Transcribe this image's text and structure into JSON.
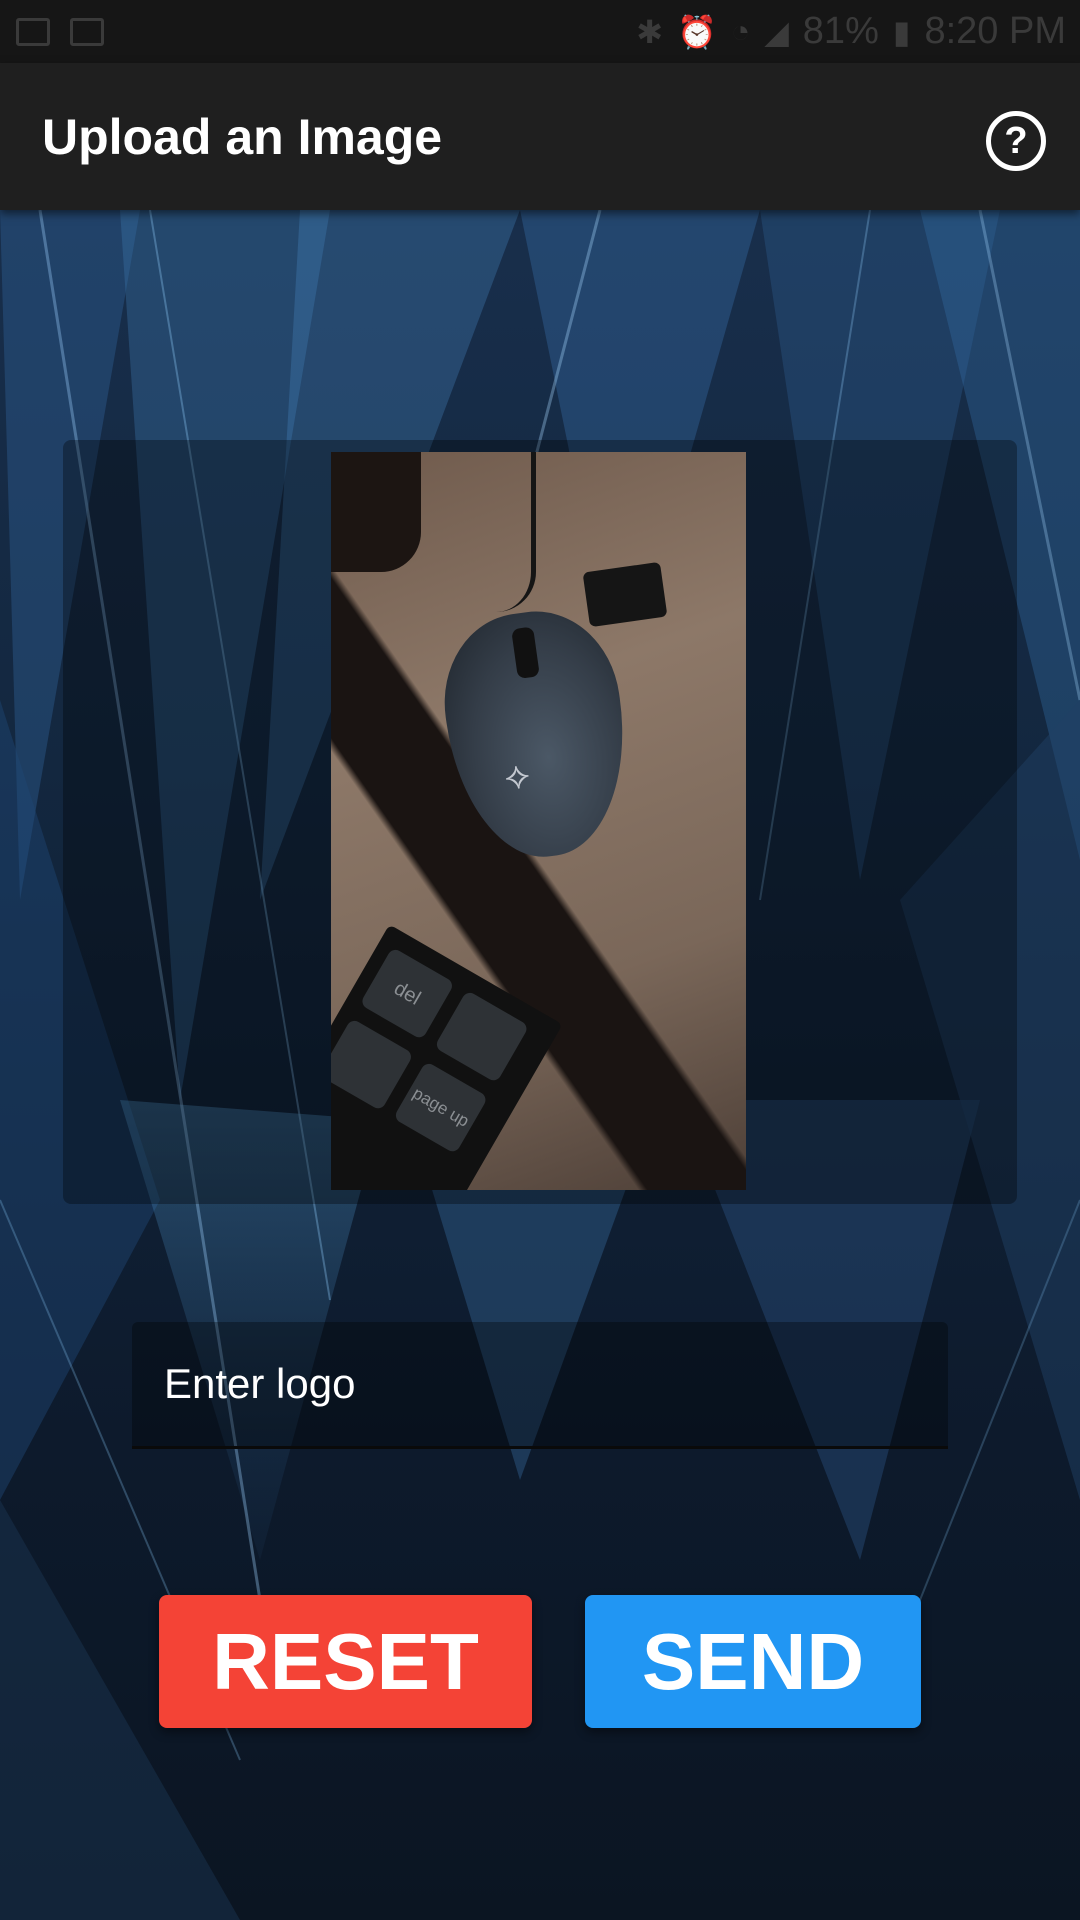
{
  "status_bar": {
    "battery": "81%",
    "time": "8:20 PM",
    "icons": [
      "image-icon",
      "news-icon",
      "bluetooth-icon",
      "alarm-icon",
      "wifi-icon",
      "signal-icon",
      "battery-icon"
    ]
  },
  "app_bar": {
    "title": "Upload an Image",
    "help_icon": "?"
  },
  "image_preview": {
    "keys": [
      "del",
      "page up"
    ]
  },
  "logo_input": {
    "placeholder": "Enter logo",
    "value": ""
  },
  "buttons": {
    "reset_label": "RESET",
    "send_label": "SEND"
  },
  "colors": {
    "reset": "#f44336",
    "send": "#2196f3",
    "app_bar": "#1f1f1f"
  }
}
